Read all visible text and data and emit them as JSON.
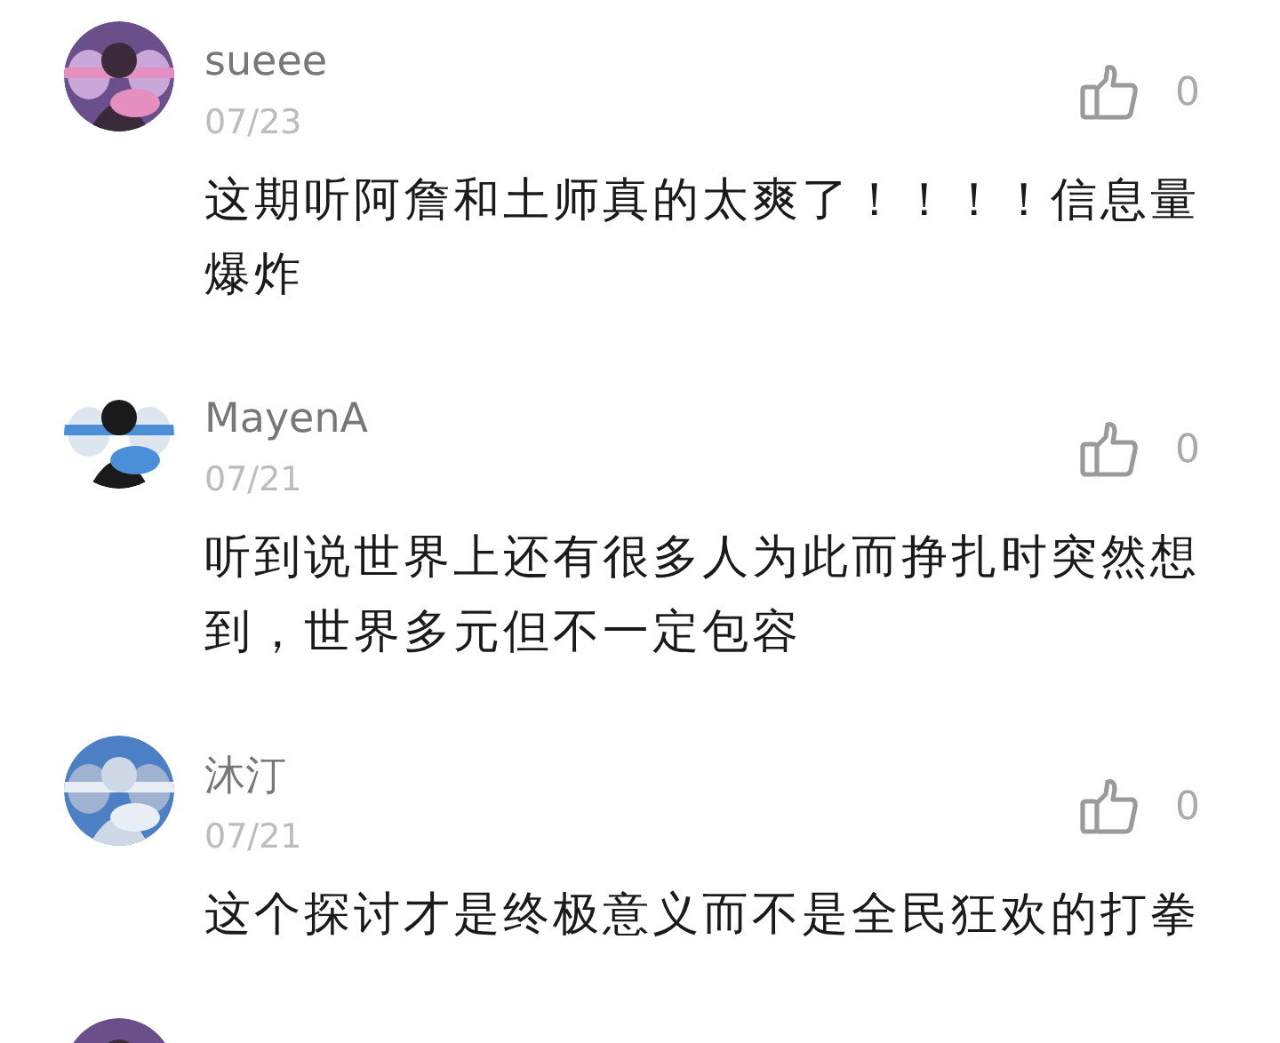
{
  "comments": [
    {
      "name": "sueee",
      "date": "07/23",
      "likes": "0",
      "text": "这期听阿詹和土师真的太爽了！！！！信息量爆炸",
      "avatar": {
        "kind": "picture"
      }
    },
    {
      "name": "MayenA",
      "date": "07/21",
      "likes": "0",
      "text": "听到说世界上还有很多人为此而挣扎时突然想到，世界多元但不一定包容",
      "avatar": {
        "kind": "picture"
      }
    },
    {
      "name": "沐汀",
      "date": "07/21",
      "likes": "0",
      "text": "这个探讨才是终极意义而不是全民狂欢的打拳",
      "avatar": {
        "kind": "picture"
      }
    },
    {
      "avatar": {
        "kind": "picture"
      }
    }
  ]
}
